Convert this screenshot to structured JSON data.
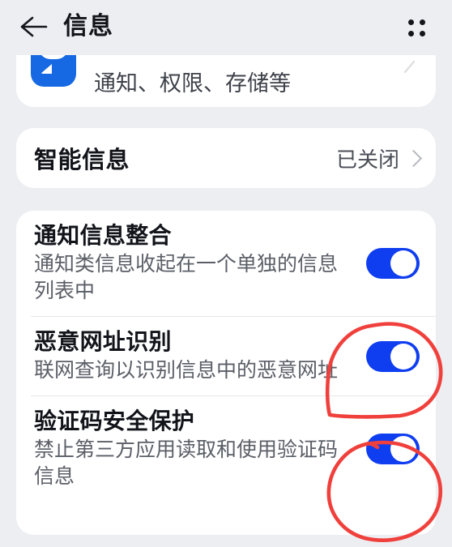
{
  "header": {
    "title": "信息",
    "back_icon": "back-arrow-icon",
    "menu_icon": "grid-dots-menu-icon"
  },
  "cards": {
    "app_entry": {
      "icon": "messages-app-icon",
      "subtitle": "通知、权限、存储等",
      "chevron": "chevron-right-icon"
    },
    "smart_messages": {
      "title": "智能信息",
      "value": "已关闭",
      "chevron": "chevron-right-icon"
    },
    "toggles": [
      {
        "title": "通知信息整合",
        "desc": "通知类信息收起在一个单独的信息列表中",
        "on": true,
        "annotated": false
      },
      {
        "title": "恶意网址识别",
        "desc": "联网查询以识别信息中的恶意网址",
        "on": true,
        "annotated": true
      },
      {
        "title": "验证码安全保护",
        "desc": "禁止第三方应用读取和使用验证码信息",
        "on": true,
        "annotated": true
      }
    ]
  },
  "colors": {
    "background": "#eceef2",
    "card": "#ffffff",
    "toggle_on": "#0f3df0",
    "annotation_red": "#f0403c",
    "title_text": "#12141a",
    "desc_text": "#5a5e66",
    "app_icon_blue": "#1668e3"
  }
}
